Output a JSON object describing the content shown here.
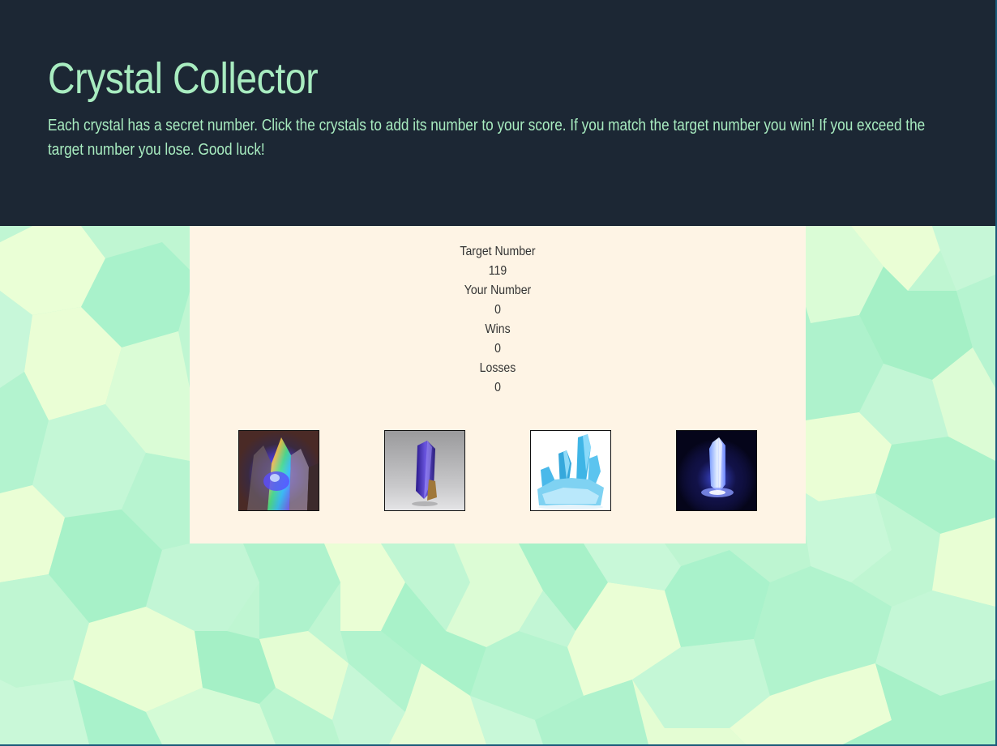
{
  "header": {
    "title": "Crystal Collector",
    "description": "Each crystal has a secret number. Click the crystals to add its number to your score. If you match the target number you win! If you exceed the target number you lose. Good luck!"
  },
  "stats": {
    "target_label": "Target Number",
    "target_value": "119",
    "your_label": "Your Number",
    "your_value": "0",
    "wins_label": "Wins",
    "wins_value": "0",
    "losses_label": "Losses",
    "losses_value": "0"
  },
  "crystals": [
    {
      "name": "rainbow-crystal-image"
    },
    {
      "name": "tanzanite-crystal-image"
    },
    {
      "name": "blue-quartz-crystal-image"
    },
    {
      "name": "glowing-crystal-image"
    }
  ],
  "colors": {
    "header_bg": "#1c2734",
    "header_text": "#a8ecc0",
    "panel_bg": "#fef4e5",
    "stat_text": "#333333"
  }
}
